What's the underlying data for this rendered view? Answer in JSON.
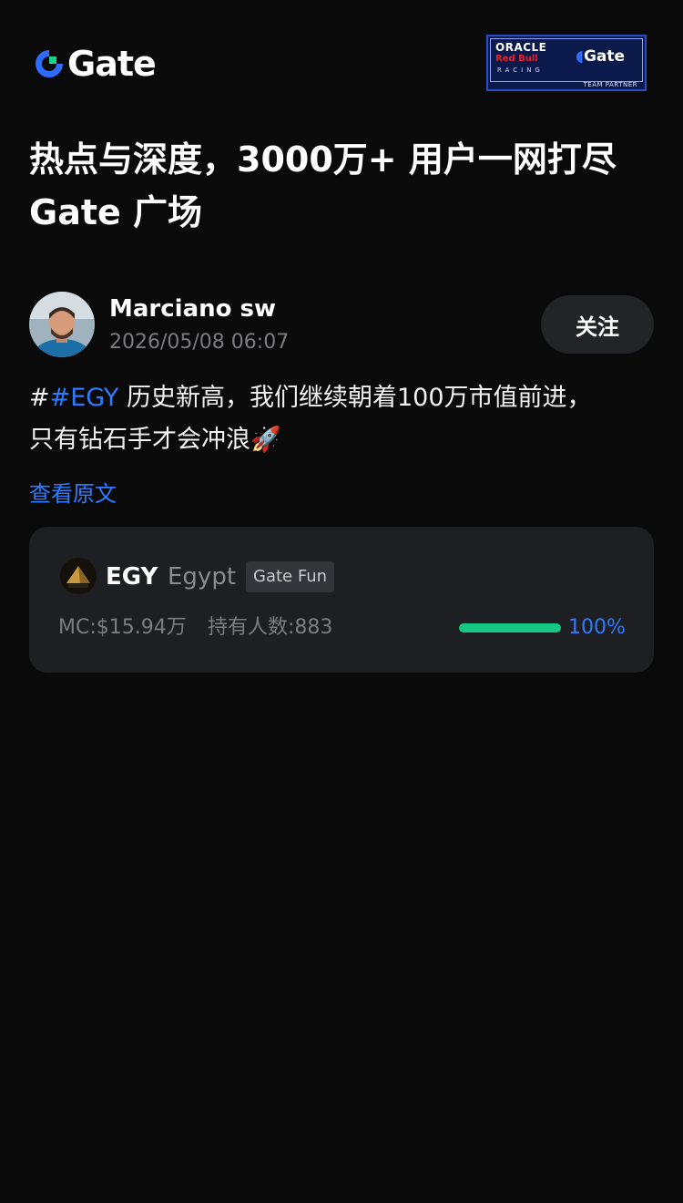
{
  "header": {
    "logo_text": "Gate",
    "partner": {
      "oracle": "ORACLE",
      "red_bull": "Red Bull",
      "racing": "RACING",
      "gate": "Gate",
      "team_partner": "TEAM PARTNER"
    }
  },
  "headline": {
    "line1": "热点与深度，3000万+ 用户一网打尽",
    "line2": "Gate 广场"
  },
  "post": {
    "author": "Marciano sw",
    "timestamp": "2026/05/08 06:07",
    "follow_label": "关注",
    "hash": "#",
    "tag": "#EGY",
    "text_line1": " 历史新高，我们继续朝着100万市值前进，",
    "text_line2": "只有钻石手才会冲浪🚀",
    "view_original": "查看原文"
  },
  "token": {
    "symbol": "EGY",
    "name": "Egypt",
    "badge": "Gate Fun",
    "icon_label": "Egypt",
    "market_cap": "MC:$15.94万",
    "holders": "持有人数:883",
    "progress_percent": 100,
    "progress_label": "100%"
  },
  "colors": {
    "background": "#0a0a0a",
    "accent_blue": "#2f7bff",
    "progress_green": "#16c784",
    "card_bg": "#1e1f22"
  }
}
